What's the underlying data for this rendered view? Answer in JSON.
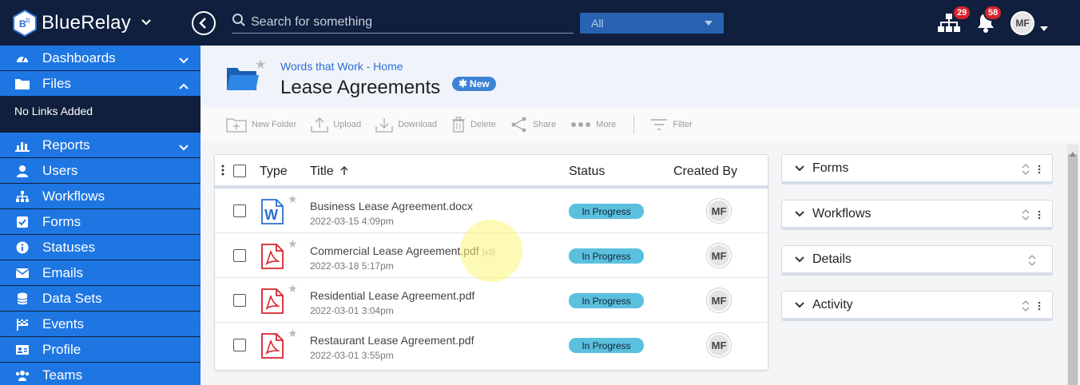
{
  "app": {
    "name": "BlueRelay"
  },
  "topbar": {
    "search_placeholder": "Search for something",
    "scope_value": "All",
    "org_badge": "29",
    "notifications_badge": "58",
    "user_initials": "MF"
  },
  "sidebar": {
    "items": [
      {
        "label": "Dashboards",
        "icon": "dashboard-icon",
        "chevron": "down"
      },
      {
        "label": "Files",
        "icon": "folder-icon",
        "chevron": "up"
      },
      {
        "label": "Reports",
        "icon": "chart-icon",
        "chevron": "down"
      },
      {
        "label": "Users",
        "icon": "user-icon"
      },
      {
        "label": "Workflows",
        "icon": "sitemap-icon"
      },
      {
        "label": "Forms",
        "icon": "checkbox-icon"
      },
      {
        "label": "Statuses",
        "icon": "info-icon"
      },
      {
        "label": "Emails",
        "icon": "envelope-icon"
      },
      {
        "label": "Data Sets",
        "icon": "database-icon"
      },
      {
        "label": "Events",
        "icon": "flag-icon"
      },
      {
        "label": "Profile",
        "icon": "id-card-icon"
      },
      {
        "label": "Teams",
        "icon": "users-icon"
      }
    ],
    "files_sub": "No Links Added"
  },
  "header": {
    "breadcrumb": "Words that Work - Home",
    "title": "Lease Agreements",
    "new_badge": "New"
  },
  "toolbar": {
    "new_folder": "New Folder",
    "upload": "Upload",
    "download": "Download",
    "delete": "Delete",
    "share": "Share",
    "more": "More",
    "filter": "Filter"
  },
  "table": {
    "headers": {
      "type": "Type",
      "title": "Title",
      "status": "Status",
      "created_by": "Created By"
    },
    "rows": [
      {
        "type": "word",
        "title": "Business Lease Agreement.docx",
        "version": "",
        "date": "2022-03-15 4:09pm",
        "status": "In Progress",
        "creator": "MF"
      },
      {
        "type": "pdf",
        "title": "Commercial Lease Agreement.pdf",
        "version": "[v2]",
        "date": "2022-03-18 5:17pm",
        "status": "In Progress",
        "creator": "MF"
      },
      {
        "type": "pdf",
        "title": "Residential Lease Agreement.pdf",
        "version": "",
        "date": "2022-03-01 3:04pm",
        "status": "In Progress",
        "creator": "MF"
      },
      {
        "type": "pdf",
        "title": "Restaurant Lease Agreement.pdf",
        "version": "",
        "date": "2022-03-01 3:55pm",
        "status": "In Progress",
        "creator": "MF"
      }
    ]
  },
  "panels": [
    {
      "label": "Forms",
      "has_menu": true
    },
    {
      "label": "Workflows",
      "has_menu": true
    },
    {
      "label": "Details",
      "has_menu": false
    },
    {
      "label": "Activity",
      "has_menu": true
    }
  ],
  "colors": {
    "topbar": "#0f1f3d",
    "sidebar_item": "#1e76e3",
    "status_pill": "#5bc0de",
    "badge": "#d9232e",
    "pdf_red": "#d9232e",
    "word_blue": "#2b6fd0"
  }
}
